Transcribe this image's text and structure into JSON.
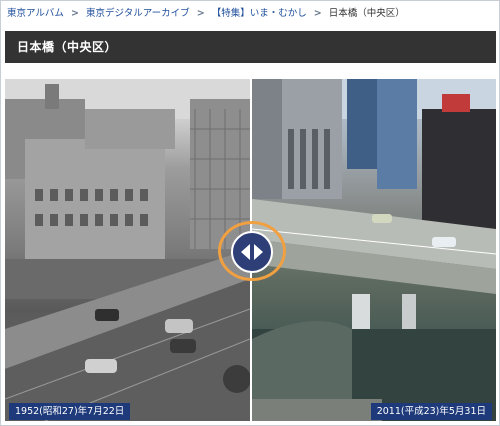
{
  "breadcrumb": {
    "items": [
      {
        "label": "東京アルバム",
        "link": true
      },
      {
        "label": "東京デジタルアーカイブ",
        "link": true
      },
      {
        "label": "【特集】いま・むかし",
        "link": true
      },
      {
        "label": "日本橋（中央区）",
        "link": false
      }
    ],
    "separator": ">"
  },
  "page": {
    "title": "日本橋（中央区）"
  },
  "compare": {
    "left_date": "1952(昭和27)年7月22日",
    "right_date": "2011(平成23)年5月31日",
    "slider_position": 0.5
  },
  "colors": {
    "title_bar": "#333333",
    "date_label": "#1e3a7a",
    "handle": "#2e3f78",
    "handle_ring": "#f0a040",
    "link": "#1f4e9c"
  },
  "icons": [
    "chevron-left-icon",
    "chevron-right-icon"
  ]
}
